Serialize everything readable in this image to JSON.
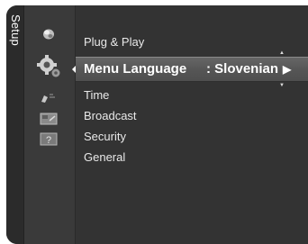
{
  "sidebar": {
    "title": "Setup"
  },
  "icons": [
    {
      "name": "picture-icon"
    },
    {
      "name": "setup-icon"
    },
    {
      "name": "input-icon"
    },
    {
      "name": "application-icon"
    },
    {
      "name": "support-icon"
    }
  ],
  "menu": {
    "items": [
      {
        "label": "Plug & Play"
      },
      {
        "label": "Menu Language",
        "value": ": Slovenian"
      },
      {
        "label": "Time"
      },
      {
        "label": "Broadcast"
      },
      {
        "label": "Security"
      },
      {
        "label": "General"
      }
    ],
    "selected_index": 1
  },
  "colors": {
    "background": "#343434",
    "highlight": "#5a5a5a",
    "text": "#ffffff"
  }
}
